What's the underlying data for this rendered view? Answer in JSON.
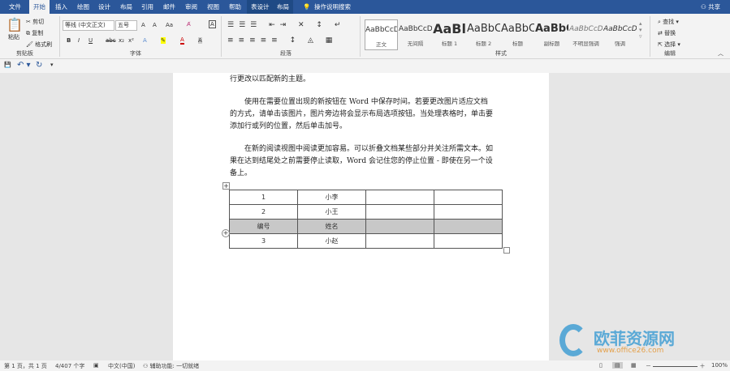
{
  "tabs": [
    "文件",
    "开始",
    "插入",
    "绘图",
    "设计",
    "布局",
    "引用",
    "邮件",
    "审阅",
    "视图",
    "帮助",
    "表设计",
    "布局"
  ],
  "search": "操作说明搜索",
  "share": "共享",
  "clipboard": {
    "paste": "粘贴",
    "cut": "剪切",
    "copy": "复制",
    "format_painter": "格式刷",
    "group": "剪贴板"
  },
  "font": {
    "name": "等线 (中文正文)",
    "size": "五号",
    "group": "字体",
    "bold": "B",
    "italic": "I",
    "underline": "U",
    "strike": "abc",
    "sub": "x₂",
    "sup": "x²",
    "grow": "A",
    "shrink": "A",
    "case": "Aa"
  },
  "paragraph": {
    "group": "段落"
  },
  "styles": {
    "group": "样式",
    "items": [
      {
        "preview": "AaBbCcDc",
        "label": "正文"
      },
      {
        "preview": "AaBbCcDc",
        "label": "无间隔"
      },
      {
        "preview": "AaBl",
        "label": "标题 1"
      },
      {
        "preview": "AaBbC",
        "label": "标题 2"
      },
      {
        "preview": "AaBbC",
        "label": "标题"
      },
      {
        "preview": "AaBbC",
        "label": "副标题"
      },
      {
        "preview": "AaBbCcDi",
        "label": "不明显强调"
      },
      {
        "preview": "AaBbCcDi",
        "label": "强调"
      }
    ]
  },
  "editing": {
    "find": "查找",
    "replace": "替换",
    "select": "选择",
    "group": "编辑"
  },
  "document": {
    "paragraphs": [
      "行更改以匹配新的主题。",
      "　　使用在需要位置出现的新按钮在 Word 中保存时间。若要更改图片适应文档的方式，请单击该图片，图片旁边将会显示布局选项按钮。当处理表格时，单击要添加行或列的位置，然后单击加号。",
      "　　在新的阅读视图中阅读更加容易。可以折叠文档某些部分并关注所需文本。如果在达到结尾处之前需要停止读取，Word 会记住您的停止位置 - 即使在另一个设备上。"
    ],
    "table": [
      [
        "1",
        "小李",
        "",
        ""
      ],
      [
        "2",
        "小王",
        "",
        ""
      ],
      [
        "编号",
        "姓名",
        "",
        ""
      ],
      [
        "3",
        "小赵",
        "",
        ""
      ]
    ]
  },
  "status": {
    "page": "第 1 页，共 1 页",
    "words": "4/407 个字",
    "lang": "中文(中国)",
    "access": "辅助功能: 一切就绪",
    "zoom": "100%"
  },
  "watermark": {
    "name": "欧菲资源网",
    "url": "www.office26.com"
  },
  "colors": {
    "accent": "#2b579a"
  }
}
